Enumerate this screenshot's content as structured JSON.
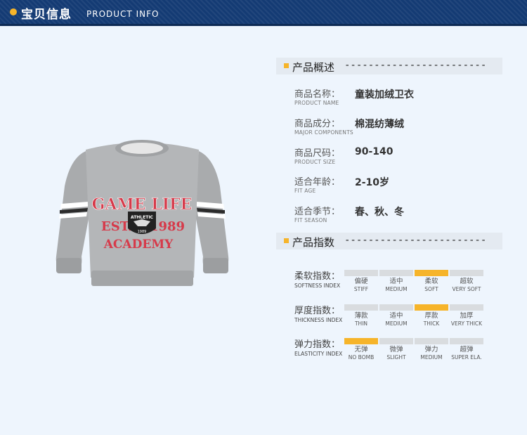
{
  "header": {
    "title_cn": "宝贝信息",
    "title_en": "PRODUCT INFO"
  },
  "product_image": {
    "print_line1": "GAME LIFE",
    "print_est": "EST.",
    "print_year": "1989",
    "print_line3": "ACADEMY",
    "badge_top": "ATHLETIC",
    "badge_bottom": "1989"
  },
  "overview": {
    "title": "产品概述",
    "dashes": "------------------------",
    "rows": [
      {
        "cn": "商品名称：",
        "en": "PRODUCT NAME",
        "value": "童装加绒卫衣"
      },
      {
        "cn": "商品成分：",
        "en": "MAJOR COMPONENTS",
        "value": "棉混纺薄绒"
      },
      {
        "cn": "商品尺码：",
        "en": "PRODUCT SIZE",
        "value": "90-140"
      },
      {
        "cn": "适合年龄：",
        "en": "FIT AGE",
        "value": "2-10岁"
      },
      {
        "cn": "适合季节：",
        "en": "FIT SEASON",
        "value": "春、秋、冬"
      }
    ]
  },
  "indices": {
    "title": "产品指数",
    "dashes": "------------------------",
    "accent_color": "#f6b42a",
    "rows": [
      {
        "cn": "柔软指数：",
        "en": "SOFTNESS INDEX",
        "selected": 2,
        "options": [
          {
            "cn": "偏硬",
            "en": "STIFF"
          },
          {
            "cn": "适中",
            "en": "MEDIUM"
          },
          {
            "cn": "柔软",
            "en": "SOFT"
          },
          {
            "cn": "超软",
            "en": "VERY SOFT"
          }
        ]
      },
      {
        "cn": "厚度指数：",
        "en": "THICKNESS INDEX",
        "selected": 2,
        "options": [
          {
            "cn": "薄款",
            "en": "THIN"
          },
          {
            "cn": "适中",
            "en": "MEDIUM"
          },
          {
            "cn": "厚款",
            "en": "THICK"
          },
          {
            "cn": "加厚",
            "en": "VERY THICK"
          }
        ]
      },
      {
        "cn": "弹力指数：",
        "en": "ELASTICITY INDEX",
        "selected": 0,
        "options": [
          {
            "cn": "无弹",
            "en": "NO BOMB"
          },
          {
            "cn": "微弹",
            "en": "SLIGHT"
          },
          {
            "cn": "弹力",
            "en": "MEDIUM"
          },
          {
            "cn": "超弹",
            "en": "SUPER ELA."
          }
        ]
      }
    ]
  }
}
